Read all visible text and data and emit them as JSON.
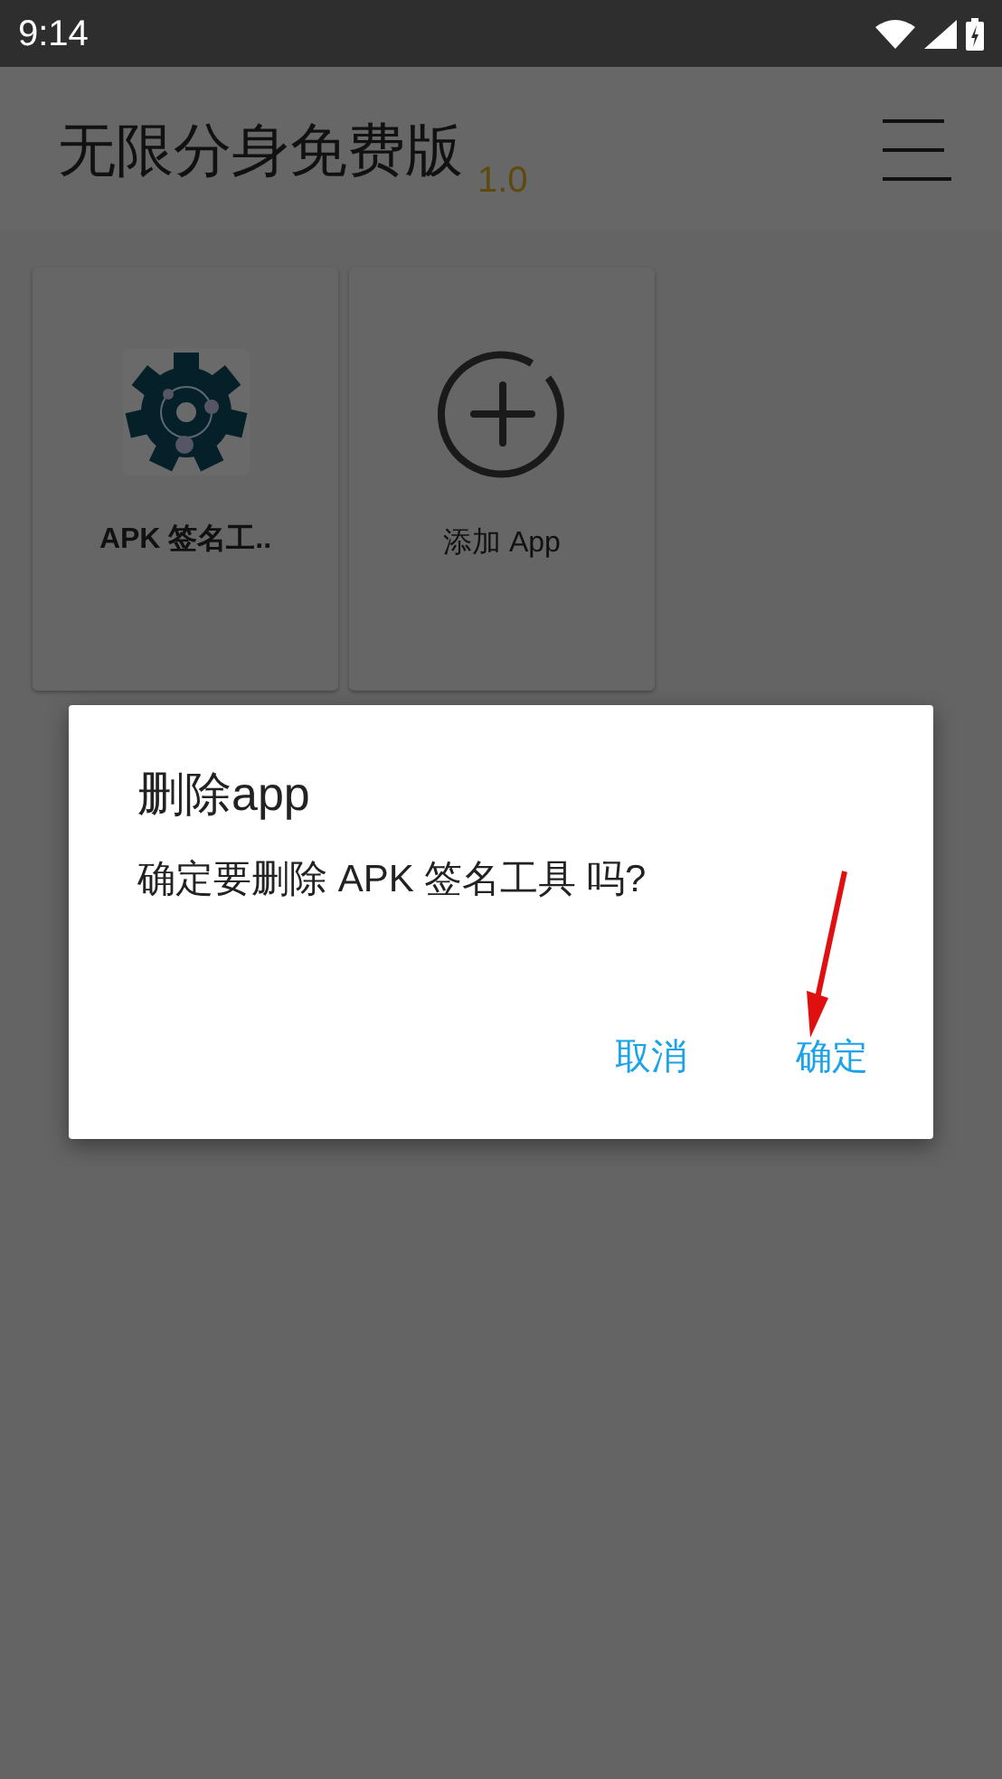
{
  "status_bar": {
    "time": "9:14"
  },
  "app_bar": {
    "title": "无限分身免费版",
    "version": "1.0"
  },
  "apps": [
    {
      "kind": "app",
      "label": "APK 签名工.."
    },
    {
      "kind": "add",
      "label": "添加 App"
    }
  ],
  "dialog": {
    "title": "删除app",
    "message": "确定要删除 APK 签名工具 吗?",
    "buttons": [
      "取消",
      "确定"
    ]
  }
}
